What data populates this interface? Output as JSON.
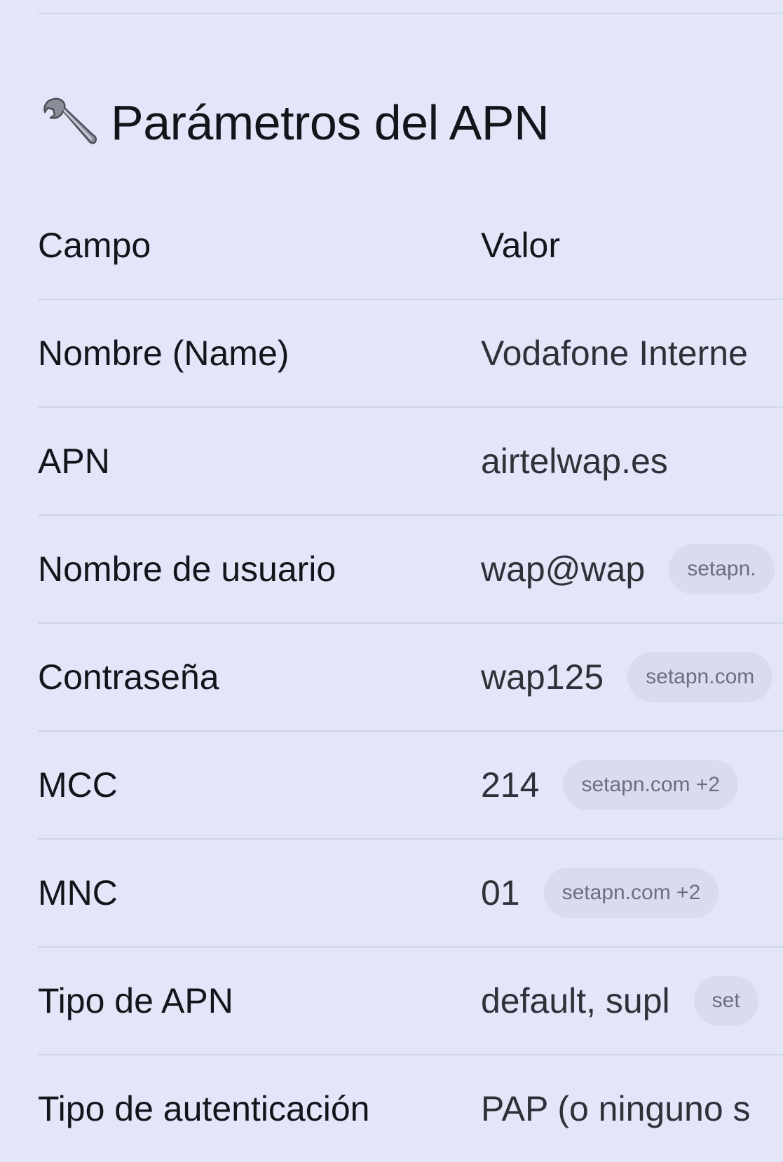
{
  "heading": {
    "icon": "wrench-icon",
    "title": "Parámetros del APN"
  },
  "table": {
    "columns": [
      "Campo",
      "Valor"
    ],
    "rows": [
      {
        "field": "Nombre (Name)",
        "value": "Vodafone Interne",
        "source": ""
      },
      {
        "field": "APN",
        "value": "airtelwap.es",
        "source": ""
      },
      {
        "field": "Nombre de usuario",
        "value": "wap@wap",
        "source": "setapn."
      },
      {
        "field": "Contraseña",
        "value": "wap125",
        "source": "setapn.com"
      },
      {
        "field": "MCC",
        "value": "214",
        "source": "setapn.com +2"
      },
      {
        "field": "MNC",
        "value": "01",
        "source": "setapn.com +2"
      },
      {
        "field": "Tipo de APN",
        "value": "default, supl",
        "source": "set"
      },
      {
        "field": "Tipo de autenticación",
        "value": "PAP (o ninguno s",
        "source": ""
      }
    ]
  },
  "colors": {
    "background": "#e2e6f8",
    "text": "#14151b",
    "divider": "#d1d5e8",
    "chip_background": "#d8dcee",
    "chip_text": "#6c6f7c"
  }
}
